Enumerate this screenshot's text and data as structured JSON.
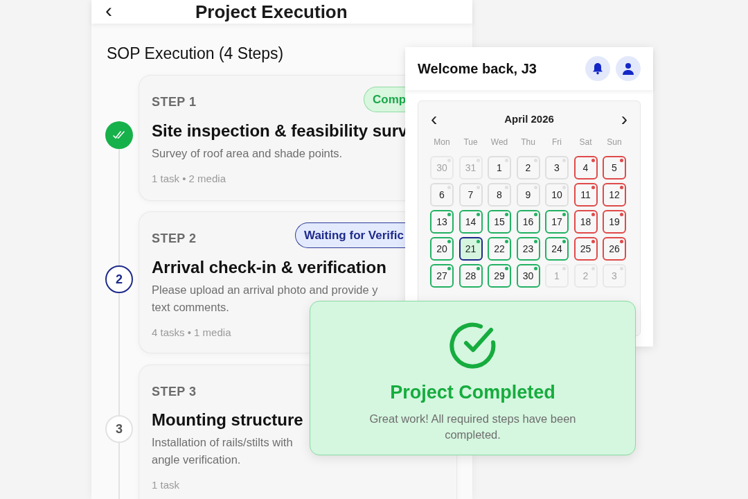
{
  "header": {
    "back": "‹",
    "title": "Project Execution"
  },
  "section_title": "SOP Execution (4 Steps)",
  "steps": [
    {
      "kind": "done",
      "label": "STEP 1",
      "badge": {
        "kind": "completed",
        "text": "Comp"
      },
      "title": "Site inspection & feasibility surv",
      "description": [
        "Survey of roof area and shade points."
      ],
      "meta": "1 task • 2 media"
    },
    {
      "kind": "current",
      "node": "2",
      "label": "STEP 2",
      "badge": {
        "kind": "waiting",
        "text": "Waiting for Verific"
      },
      "title": "Arrival check-in & verification",
      "description": [
        "Please upload an arrival photo and provide y",
        "text comments."
      ],
      "meta": "4 tasks • 1 media"
    },
    {
      "kind": "pending",
      "node": "3",
      "label": "STEP 3",
      "title": "Mounting structure",
      "description": [
        "Installation of rails/stilts with",
        "angle verification."
      ],
      "meta": "1 task"
    }
  ],
  "dashboard": {
    "greeting": "Welcome back, J3",
    "calendar": {
      "prev": "‹",
      "month": "April 2026",
      "next": "›",
      "weekdays": [
        "Mon",
        "Tue",
        "Wed",
        "Thu",
        "Fri",
        "Sat",
        "Sun"
      ],
      "days": [
        {
          "day": "30",
          "kind": "outside",
          "selected": false
        },
        {
          "day": "31",
          "kind": "outside",
          "selected": false
        },
        {
          "day": "1",
          "kind": "default",
          "selected": false
        },
        {
          "day": "2",
          "kind": "default",
          "selected": false
        },
        {
          "day": "3",
          "kind": "default",
          "selected": false
        },
        {
          "day": "4",
          "kind": "unavailable",
          "selected": false
        },
        {
          "day": "5",
          "kind": "unavailable",
          "selected": false
        },
        {
          "day": "6",
          "kind": "default",
          "selected": false
        },
        {
          "day": "7",
          "kind": "default",
          "selected": false
        },
        {
          "day": "8",
          "kind": "default",
          "selected": false
        },
        {
          "day": "9",
          "kind": "default",
          "selected": false
        },
        {
          "day": "10",
          "kind": "default",
          "selected": false
        },
        {
          "day": "11",
          "kind": "unavailable",
          "selected": false
        },
        {
          "day": "12",
          "kind": "unavailable",
          "selected": false
        },
        {
          "day": "13",
          "kind": "available",
          "selected": false
        },
        {
          "day": "14",
          "kind": "available",
          "selected": false
        },
        {
          "day": "15",
          "kind": "available",
          "selected": false
        },
        {
          "day": "16",
          "kind": "available",
          "selected": false
        },
        {
          "day": "17",
          "kind": "available",
          "selected": false
        },
        {
          "day": "18",
          "kind": "unavailable",
          "selected": false
        },
        {
          "day": "19",
          "kind": "unavailable",
          "selected": false
        },
        {
          "day": "20",
          "kind": "available",
          "selected": false
        },
        {
          "day": "21",
          "kind": "available",
          "selected": true
        },
        {
          "day": "22",
          "kind": "available",
          "selected": false
        },
        {
          "day": "23",
          "kind": "available",
          "selected": false
        },
        {
          "day": "24",
          "kind": "available",
          "selected": false
        },
        {
          "day": "25",
          "kind": "unavailable",
          "selected": false
        },
        {
          "day": "26",
          "kind": "unavailable",
          "selected": false
        },
        {
          "day": "27",
          "kind": "available",
          "selected": false
        },
        {
          "day": "28",
          "kind": "available",
          "selected": false
        },
        {
          "day": "29",
          "kind": "available",
          "selected": false
        },
        {
          "day": "30",
          "kind": "available",
          "selected": false
        },
        {
          "day": "1",
          "kind": "outside",
          "selected": false
        },
        {
          "day": "2",
          "kind": "outside",
          "selected": false
        },
        {
          "day": "3",
          "kind": "outside",
          "selected": false
        }
      ]
    }
  },
  "toast": {
    "title": "Project Completed",
    "message": "Great work! All required steps have been completed."
  }
}
